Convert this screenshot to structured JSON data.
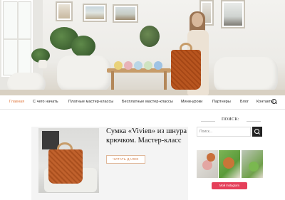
{
  "nav": {
    "items": [
      {
        "label": "Главная",
        "active": true
      },
      {
        "label": "С чего начать",
        "active": false
      },
      {
        "label": "Платные мастер-классы",
        "active": false
      },
      {
        "label": "Бесплатные мастер-классы",
        "active": false
      },
      {
        "label": "Мини-уроки",
        "active": false
      },
      {
        "label": "Партнеры",
        "active": false
      },
      {
        "label": "Блог",
        "active": false
      },
      {
        "label": "Контакты",
        "active": false
      }
    ],
    "search_icon": "search-icon",
    "active_color": "#e0763b"
  },
  "post": {
    "title": "Сумка «Vivien» из шнура крючком. Мастер-класс",
    "read_more": "ЧИТАТЬ ДАЛЕЕ"
  },
  "sidebar": {
    "search_title": "ПОИСК:",
    "search_placeholder": "Поиск...",
    "search_icon": "search-icon",
    "instagram_button": "Мой Instagram"
  },
  "colors": {
    "accent": "#e0763b",
    "instagram": "#e5405a",
    "dark": "#222222"
  }
}
